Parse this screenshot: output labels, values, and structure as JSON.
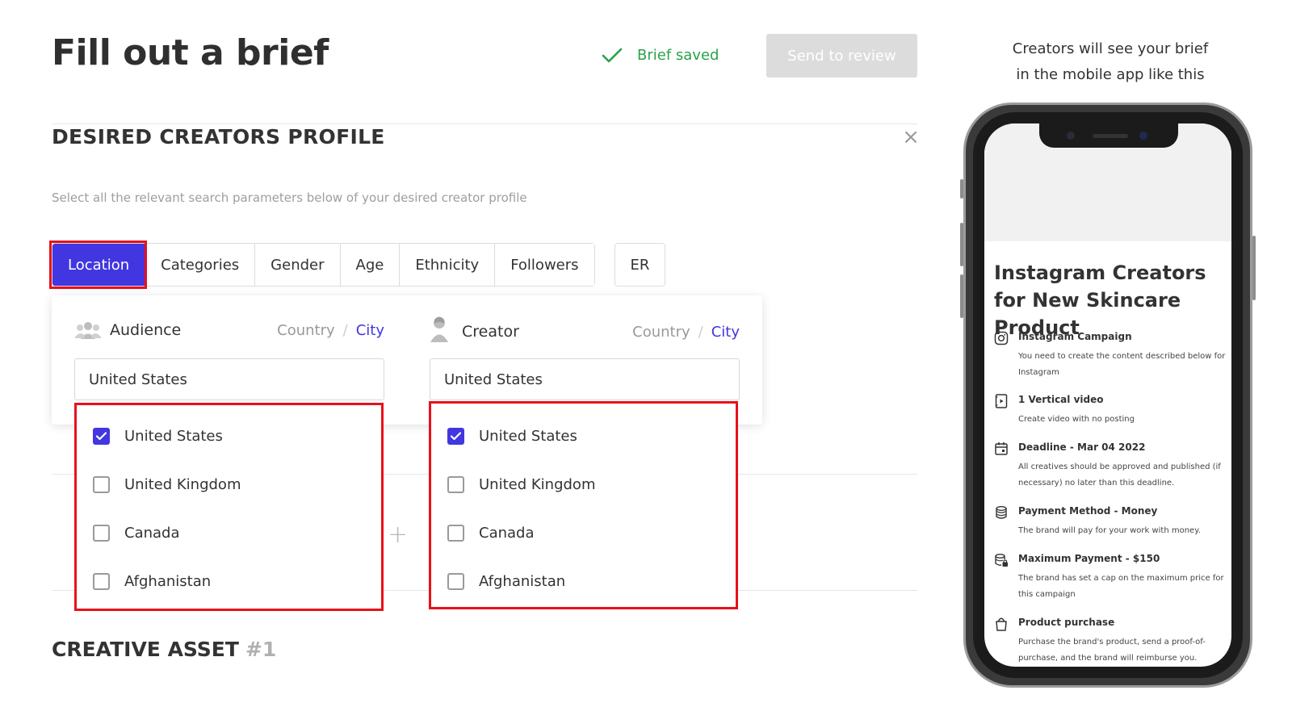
{
  "header": {
    "title": "Fill out a brief",
    "saved_status": "Brief saved",
    "send_button": "Send to review"
  },
  "section": {
    "title": "DESIRED CREATORS PROFILE",
    "description": "Select all the relevant search parameters below of your desired creator profile"
  },
  "tabs": [
    {
      "label": "Location",
      "active": true
    },
    {
      "label": "Categories"
    },
    {
      "label": "Gender"
    },
    {
      "label": "Age"
    },
    {
      "label": "Ethnicity"
    },
    {
      "label": "Followers"
    }
  ],
  "tab_er": "ER",
  "audience": {
    "label": "Audience",
    "toggle_country": "Country",
    "toggle_sep": "/",
    "toggle_city": "City",
    "field_value": "United States",
    "options": [
      {
        "label": "United States",
        "checked": true
      },
      {
        "label": "United Kingdom",
        "checked": false
      },
      {
        "label": "Canada",
        "checked": false
      },
      {
        "label": "Afghanistan",
        "checked": false
      }
    ]
  },
  "creator": {
    "label": "Creator",
    "toggle_country": "Country",
    "toggle_sep": "/",
    "toggle_city": "City",
    "field_value": "United States",
    "options": [
      {
        "label": "United States",
        "checked": true
      },
      {
        "label": "United Kingdom",
        "checked": false
      },
      {
        "label": "Canada",
        "checked": false
      },
      {
        "label": "Afghanistan",
        "checked": false
      }
    ]
  },
  "creative_asset": {
    "title": "CREATIVE ASSET",
    "number": "#1"
  },
  "preview": {
    "caption_line1": "Creators will see your brief",
    "caption_line2": "in the mobile app like this",
    "campaign_title": "Instagram Creators for New Skincare Product",
    "items": [
      {
        "icon": "instagram-icon",
        "title": "Instagram Campaign",
        "desc": "You need to create the content described below for Instagram"
      },
      {
        "icon": "video-icon",
        "title": "1 Vertical video",
        "desc": "Create video with no posting"
      },
      {
        "icon": "calendar-icon",
        "title": "Deadline - Mar 04 2022",
        "desc": "All creatives should be approved and published (if necessary) no later than this deadline."
      },
      {
        "icon": "coins-icon",
        "title": "Payment Method - Money",
        "desc": "The brand will pay for your work with money."
      },
      {
        "icon": "coins-lock-icon",
        "title": "Maximum Payment - $150",
        "desc": "The brand has set a cap on the maximum price for this campaign"
      },
      {
        "icon": "shopping-bag-icon",
        "title": "Product purchase",
        "desc": "Purchase the brand's product, send a proof-of-purchase, and the brand will reimburse you."
      }
    ]
  },
  "colors": {
    "accent": "#4136e0",
    "saved_green": "#2aa24a",
    "highlight_red": "#e8101a",
    "disabled_button": "#dcdcdc"
  }
}
